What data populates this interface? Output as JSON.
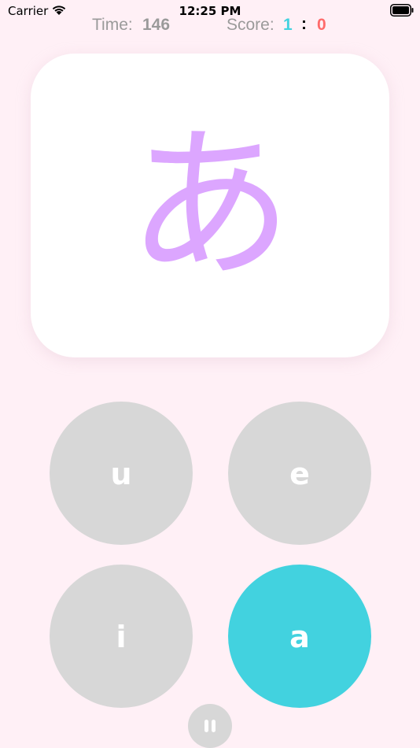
{
  "status_bar": {
    "carrier": "Carrier",
    "time": "12:25 PM",
    "icons": [
      "wifi-icon",
      "battery-icon"
    ]
  },
  "header": {
    "time_label": "Time:",
    "time_value": "146",
    "score_label": "Score:",
    "score_left": "1",
    "score_separator": ":",
    "score_right": "0"
  },
  "card": {
    "character": "あ"
  },
  "answers": [
    {
      "label": "u"
    },
    {
      "label": "e"
    },
    {
      "label": "i"
    },
    {
      "label": "a"
    }
  ],
  "pause": {
    "icon": "pause-icon"
  },
  "colors": {
    "background": "#fff0f6",
    "kana": "#dca6ff",
    "correct": "#42d2df",
    "button": "#d7d7d7",
    "score_left": "#42d2df",
    "score_right": "#ff6b6b",
    "header_text": "#9a9a9a"
  }
}
